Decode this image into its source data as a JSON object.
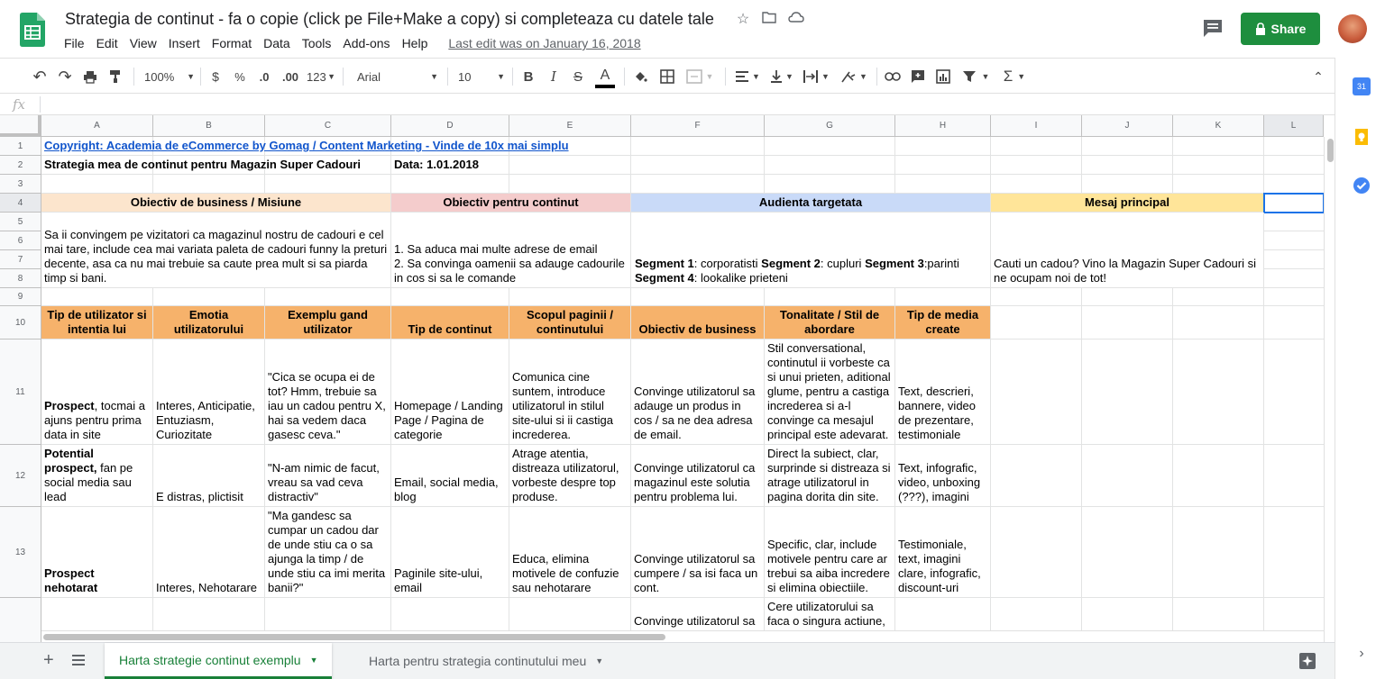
{
  "app": {
    "title": "Strategia de continut - fa o copie (click pe File+Make a copy) si completeaza cu datele tale",
    "menu": [
      "File",
      "Edit",
      "View",
      "Insert",
      "Format",
      "Data",
      "Tools",
      "Add-ons",
      "Help"
    ],
    "last_edit": "Last edit was on January 16, 2018",
    "share_label": "Share",
    "brand_color": "#1e8e3e"
  },
  "toolbar": {
    "zoom": "100%",
    "currency": "$",
    "percent": "%",
    "dec_less": ".0",
    "dec_more": ".00",
    "more_formats": "123",
    "font": "Arial",
    "font_size": "10",
    "bold": "B",
    "italic": "I",
    "strike": "S",
    "text_color": "A",
    "sum": "Σ"
  },
  "formula": {
    "fx": "fx"
  },
  "columns": [
    "A",
    "B",
    "C",
    "D",
    "E",
    "F",
    "G",
    "H",
    "I",
    "J",
    "K",
    "L"
  ],
  "rows": [
    "1",
    "2",
    "3",
    "4",
    "5",
    "6",
    "7",
    "8",
    "9",
    "10",
    "11",
    "12",
    "13"
  ],
  "sheet": {
    "r1_link": "Copyright: Academia de eCommerce by Gomag / Content Marketing - Vinde de 10x mai simplu",
    "r2_title": "Strategia mea de continut pentru Magazin Super Cadouri",
    "r2_date": "Data: 1.01.2018",
    "band_headers": [
      "Obiectiv de business / Misiune",
      "Obiectiv pentru continut",
      "Audienta targetata",
      "Mesaj principal"
    ],
    "band_colors": [
      "#fce5cd",
      "#f4cccc",
      "#c9daf8",
      "#ffe599"
    ],
    "mission": "Sa ii convingem pe vizitatori ca magazinul nostru de cadouri e cel mai tare, include cea mai variata paleta de cadouri funny la preturi decente, asa ca nu mai trebuie sa caute prea mult si sa piarda timp si bani.",
    "content_goal_1": "1. Sa aduca mai multe adrese de email",
    "content_goal_2": "2. Sa convinga oamenii sa adauge cadourile in cos si sa le comande",
    "audience": {
      "s1_label": "Segment 1",
      "s1_text": ": corporatisti ",
      "s2_label": "Segment 2",
      "s2_text": ": cupluri ",
      "s3_label": "Segment 3",
      "s3_text": ":parinti",
      "s4_label": "Segment 4",
      "s4_text": ": lookalike prieteni"
    },
    "main_message": "Cauti un cadou? Vino la Magazin Super Cadouri si ne ocupam noi de tot!",
    "table_headers": [
      "Tip de utilizator si intentia lui",
      "Emotia utilizatorului",
      "Exemplu gand utilizator",
      "Tip de continut",
      "Scopul paginii / continutului",
      "Obiectiv de business",
      "Tonalitate / Stil de abordare",
      "Tip de media create"
    ],
    "table_header_color": "#f6b26b",
    "rows_data": [
      {
        "type_bold": "Prospect",
        "type_rest": ", tocmai a ajuns pentru prima data in site",
        "emotion": "Interes, Anticipatie, Entuziasm, Curiozitate",
        "thought": "\"Cica se ocupa ei de tot? Hmm, trebuie sa iau un cadou pentru X, hai sa vedem daca gasesc ceva.\"",
        "content_type": "Homepage / Landing Page / Pagina de categorie",
        "purpose": "Comunica cine suntem, introduce utilizatorul in stilul site-ului si ii castiga increderea.",
        "business": "Convinge utilizatorul sa adauge un produs in cos / sa ne dea adresa de email.",
        "tone": "Stil conversational, continutul ii vorbeste ca si unui prieten, aditional glume, pentru a castiga increderea si a-l convinge ca mesajul principal este adevarat.",
        "media": "Text, descrieri, bannere, video de prezentare, testimoniale"
      },
      {
        "type_bold": "Potential prospect,",
        "type_rest": " fan pe social media sau lead",
        "emotion": "E distras, plictisit",
        "thought": "\"N-am nimic de facut, vreau sa vad ceva distractiv\"",
        "content_type": "Email, social media, blog",
        "purpose": "Atrage atentia, distreaza utilizatorul, vorbeste despre top produse.",
        "business": "Convinge utilizatorul ca magazinul este solutia pentru problema lui.",
        "tone": "Direct la subiect, clar, surprinde si distreaza si atrage utilizatorul in pagina dorita din site.",
        "media": "Text, infografic, video, unboxing (???), imagini"
      },
      {
        "type_bold": "Prospect nehotarat",
        "type_rest": "",
        "emotion": "Interes, Nehotarare",
        "thought": "\"Ma gandesc sa cumpar un cadou dar de unde stiu ca o sa ajunga la timp / de unde stiu ca imi merita banii?\"",
        "content_type": "Paginile site-ului, email",
        "purpose": "Educa, elimina motivele de confuzie sau nehotarare",
        "business": "Convinge utilizatorul sa cumpere / sa isi faca un cont.",
        "tone": "Specific, clar, include motivele pentru care ar trebui sa aiba incredere si elimina obiectiile.",
        "media": "Testimoniale, text, imagini clare, infografic, discount-uri"
      },
      {
        "business": "Convinge utilizatorul sa",
        "tone": "Cere utilizatorului sa faca o singura actiune,"
      }
    ]
  },
  "sheets": {
    "tab1": "Harta strategie continut exemplu",
    "tab2": "Harta pentru strategia continutului meu"
  },
  "side": {
    "calendar_day": "31"
  }
}
